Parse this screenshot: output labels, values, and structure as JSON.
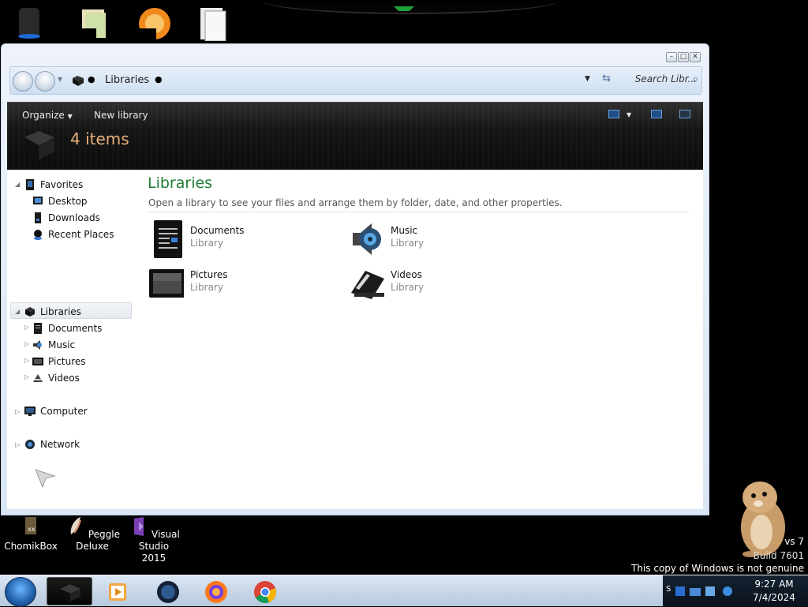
{
  "window": {
    "controls": [
      "▭",
      "▭",
      "✕"
    ],
    "breadcrumb": "Libraries",
    "search_placeholder": "Search Libr...",
    "toolbar": {
      "organize": "Organize",
      "new_library": "New library"
    },
    "item_count": "4 items"
  },
  "sidebar": {
    "favorites": "Favorites",
    "favorites_items": [
      "Desktop",
      "Downloads",
      "Recent Places"
    ],
    "libraries": "Libraries",
    "libraries_items": [
      "Documents",
      "Music",
      "Pictures",
      "Videos"
    ],
    "computer": "Computer",
    "network": "Network"
  },
  "main": {
    "title": "Libraries",
    "subtitle": "Open a library to see your files and arrange them by folder, date, and other properties.",
    "libraries": [
      {
        "name": "Documents",
        "type": "Library"
      },
      {
        "name": "Music",
        "type": "Library"
      },
      {
        "name": "Pictures",
        "type": "Library"
      },
      {
        "name": "Videos",
        "type": "Library"
      }
    ]
  },
  "desktop_icons": [
    {
      "label": "ChomikBox"
    },
    {
      "label": "Peggle Deluxe"
    },
    {
      "label": "Visual Studio 2015"
    }
  ],
  "watermark": {
    "line1": "vs 7",
    "line2": "Build 7601",
    "line3": "This copy of Windows is not genuine"
  },
  "tray": {
    "time": "9:27 AM",
    "date": "7/4/2024",
    "overflow": "S"
  }
}
